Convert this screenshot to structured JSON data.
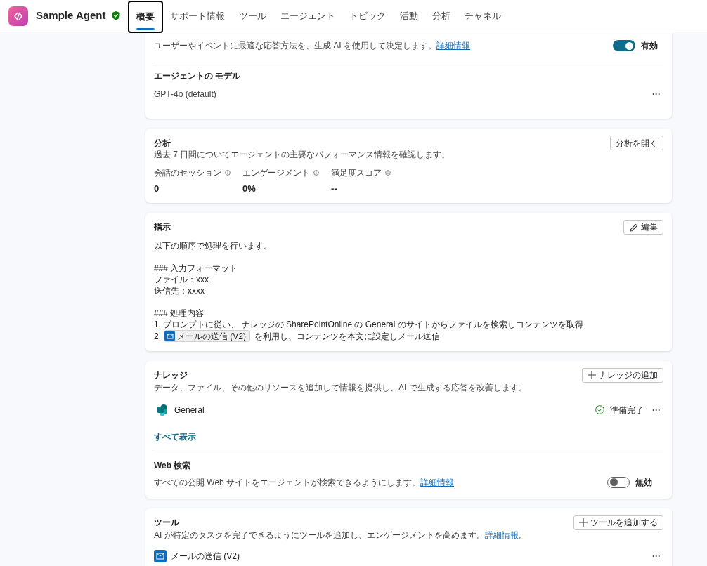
{
  "header": {
    "agent_name": "Sample Agent",
    "verified": true,
    "tabs": [
      {
        "label": "概要",
        "selected": true
      },
      {
        "label": "サポート情報",
        "selected": false
      },
      {
        "label": "ツール",
        "selected": false
      },
      {
        "label": "エージェント",
        "selected": false
      },
      {
        "label": "トピック",
        "selected": false
      },
      {
        "label": "活動",
        "selected": false
      },
      {
        "label": "分析",
        "selected": false
      },
      {
        "label": "チャネル",
        "selected": false
      }
    ]
  },
  "orchestration": {
    "description": {
      "text": "ユーザーやイベントに最適な応答方法を、生成 AI を使用して決定します。",
      "link": "詳細情報"
    },
    "toggle": {
      "on": true,
      "label": "有効"
    },
    "model": {
      "title": "エージェントの モデル",
      "value": "GPT-4o (default)",
      "more": "···"
    }
  },
  "analytics": {
    "title": "分析",
    "button": "分析を開く",
    "description": "過去 7 日間についてエージェントの主要なパフォーマンス情報を確認します。",
    "metrics": [
      {
        "label": "会話のセッション",
        "value": "0"
      },
      {
        "label": "エンゲージメント",
        "value": "0%"
      },
      {
        "label": "満足度スコア",
        "value": "--"
      }
    ]
  },
  "instructions": {
    "title": "指示",
    "button": "編集",
    "blocks": [
      [
        {
          "kind": "text",
          "text": "以下の順序で処理を行います。"
        }
      ],
      [
        {
          "kind": "text",
          "text": "### 入力フォーマット"
        },
        {
          "kind": "text",
          "text": "ファイル：xxx"
        },
        {
          "kind": "text",
          "text": "送信先：xxxx"
        }
      ],
      [
        {
          "kind": "text",
          "text": "### 処理内容"
        },
        {
          "kind": "text",
          "text": "1. プロンプトに従い、 ナレッジの SharePointOnline の General のサイトからファイルを検索しコンテンツを取得"
        },
        {
          "kind": "tool",
          "prefix": "2.",
          "chip": "メールの送信 (V2)",
          "suffix": "を利用し、コンテンツを本文に設定しメール送信"
        }
      ]
    ]
  },
  "knowledge": {
    "title": "ナレッジ",
    "button": "ナレッジの追加",
    "description": "データ、ファイル、その他のリソースを追加して情報を提供し、AI で生成する応答を改善します。",
    "items": [
      {
        "name": "General",
        "status": "準備完了",
        "more": "···"
      }
    ],
    "show_all": "すべて表示",
    "web_search": {
      "title": "Web 検索",
      "description": {
        "text": "すべての公開 Web サイトをエージェントが検索できるようにします。",
        "link": "詳細情報"
      },
      "toggle": {
        "on": false,
        "label": "無効"
      }
    }
  },
  "tools": {
    "title": "ツール",
    "button": "ツールを追加する",
    "description": {
      "text": "AI が特定のタスクを完了できるようにツールを追加し、エンゲージメントを高めます。",
      "link": "詳細情報",
      "suffix": "。"
    },
    "items": [
      {
        "name": "メールの送信 (V2)",
        "more": "···"
      }
    ]
  }
}
